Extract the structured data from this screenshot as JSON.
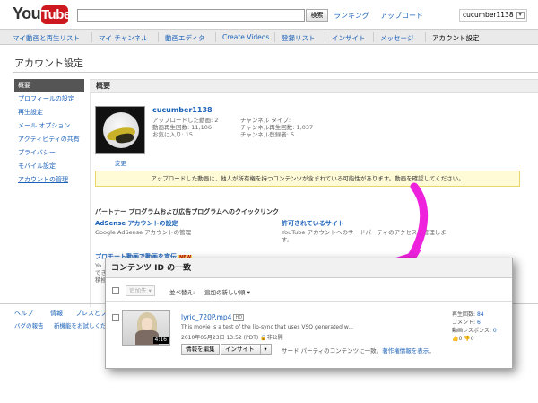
{
  "header": {
    "logo_you": "You",
    "logo_tube": "Tube",
    "search_button": "検索",
    "links": [
      "ランキング",
      "アップロード"
    ],
    "username": "cucumber1138"
  },
  "nav": {
    "items": [
      "マイ動画と再生リスト",
      "マイ チャンネル",
      "動画エディタ",
      "Create Videos",
      "登録リスト",
      "インサイト",
      "メッセージ",
      "アカウント設定"
    ],
    "active_index": 7
  },
  "page_title": "アカウント設定",
  "sidebar": {
    "items": [
      "概要",
      "プロフィールの設定",
      "再生設定",
      "メール オプション",
      "アクティビティの共有",
      "プライバシー",
      "モバイル設定",
      "アカウントの管理"
    ]
  },
  "overview": {
    "heading": "概要",
    "username": "cucumber1138",
    "change_link": "変更",
    "stats_left": [
      "アップロードした動画: 2",
      "動画再生回数: 11,106",
      "お気に入り: 15"
    ],
    "stats_right": [
      "チャンネル タイプ:",
      "チャンネル再生回数: 1,037",
      "チャンネル登録者: 5"
    ],
    "notice_text": "アップロードした動画に、他人が所有権を持つコンテンツが含まれている可能性があります。動画を確認してください。"
  },
  "partner": {
    "heading": "パートナー プログラムおよび広告プログラムへのクイックリンク",
    "adsense_title": "AdSense アカウントの設定",
    "adsense_desc": "Google AdSense アカウントの管理",
    "permitted_title": "許可されているサイト",
    "permitted_desc_1": "YouTube アカウントへのサードパーティのアクセスを管理しま",
    "permitted_desc_2": "す。",
    "promote_title": "プロモート動画で動画を宣伝",
    "promote_badge": "NEW",
    "promote_cut": [
      "Yo",
      "でき",
      "積極"
    ]
  },
  "footer": {
    "row1": [
      "ヘルプ",
      "情報",
      "プレスとブ"
    ],
    "row2": [
      "バグの報告",
      "新機能をお試しください"
    ]
  },
  "content_id": {
    "title": "コンテンツ ID の一致",
    "add_to": "追加先 ▾",
    "sort_label": "並べ替え:",
    "sort_value": "追加の新しい順 ▾",
    "video": {
      "title": "lyric_720P.mp4",
      "hd_badge": "HD",
      "duration": "4:16",
      "description": "This movie is a test of the lip-sync that uses VSQ generated w...",
      "date": "2010年05月23日 13:52 (PDT)",
      "privacy": "非公開",
      "edit_button": "情報を編集",
      "insight_button": "インサイト",
      "action_text": "サード パーティのコンテンツに一致。",
      "action_link": "著作権情報を表示",
      "action_end": "。",
      "views_label": "再生回数:",
      "views_value": "84",
      "comments_label": "コメント:",
      "comments_value": "6",
      "responses_label": "動画レスポンス:",
      "responses_value": "0",
      "likes": "0",
      "dislikes": "0"
    }
  },
  "colors": {
    "link": "#1c62b9",
    "brand_red": "#cc181e",
    "arrow": "#ee22dd",
    "notice_bg": "#fffbd6"
  }
}
